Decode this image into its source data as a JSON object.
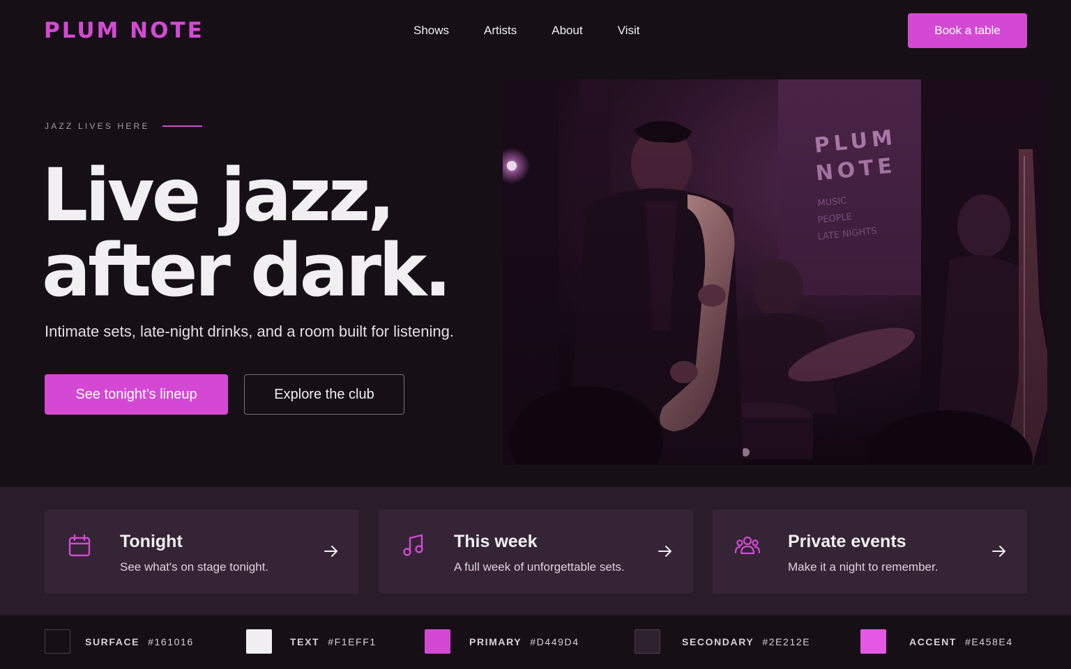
{
  "brand": {
    "logo": "PLUM NOTE"
  },
  "nav": {
    "items": [
      "Shows",
      "Artists",
      "About",
      "Visit"
    ],
    "cta": "Book a table"
  },
  "hero": {
    "eyebrow": "JAZZ LIVES HERE",
    "headline_line1": "Live jazz,",
    "headline_line2": "after dark.",
    "subline": "Intimate sets, late-night drinks, and a room built for listening.",
    "primary_cta": "See tonight’s lineup",
    "secondary_cta": "Explore the club",
    "photo": {
      "banner_title_1": "PLUM",
      "banner_title_2": "NOTE",
      "banner_line_1": "MUSIC",
      "banner_line_2": "PEOPLE",
      "banner_line_3": "LATE NIGHTS"
    }
  },
  "cards": [
    {
      "icon": "calendar-icon",
      "title": "Tonight",
      "desc": "See what's on stage tonight."
    },
    {
      "icon": "music-note-icon",
      "title": "This week",
      "desc": "A full week of unforgettable sets."
    },
    {
      "icon": "people-group-icon",
      "title": "Private events",
      "desc": "Make it a night to remember."
    }
  ],
  "palette": [
    {
      "name": "SURFACE",
      "hex": "#161016"
    },
    {
      "name": "TEXT",
      "hex": "#F1EFF1"
    },
    {
      "name": "PRIMARY",
      "hex": "#D449D4"
    },
    {
      "name": "SECONDARY",
      "hex": "#2E212E"
    },
    {
      "name": "ACCENT",
      "hex": "#E458E4"
    }
  ]
}
